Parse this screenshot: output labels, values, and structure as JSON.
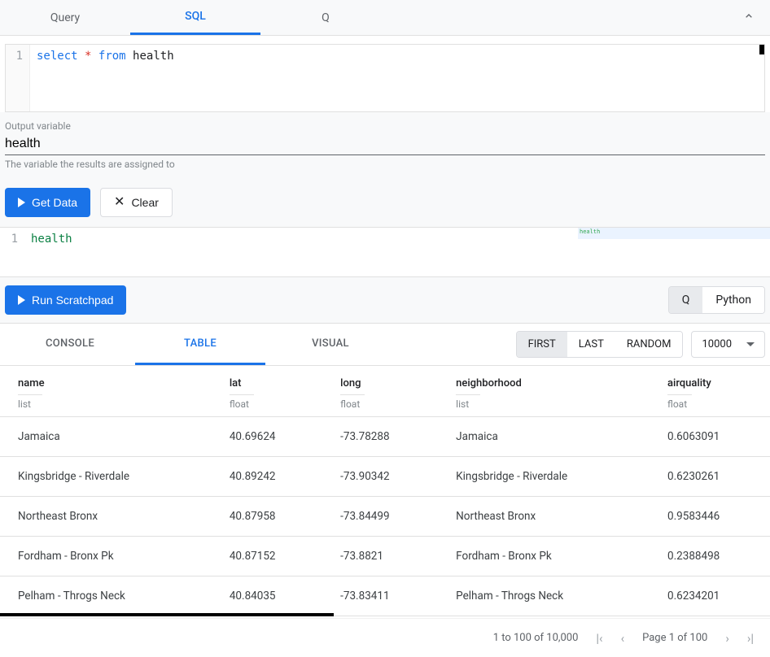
{
  "top_tabs": {
    "tab1": "Query",
    "tab2": "SQL",
    "tab3": "Q"
  },
  "editor": {
    "line_no": "1",
    "kw_select": "select",
    "star": "*",
    "kw_from": "from",
    "ident": "health"
  },
  "outvar": {
    "label": "Output variable",
    "value": "health",
    "hint": "The variable the results are assigned to"
  },
  "buttons": {
    "get_data": "Get Data",
    "clear": "Clear",
    "run_scratchpad": "Run Scratchpad"
  },
  "scratch": {
    "line_no": "1",
    "code": "health",
    "minimap": "health"
  },
  "lang": {
    "q": "Q",
    "python": "Python"
  },
  "result_tabs": {
    "console": "CONSOLE",
    "table": "TABLE",
    "visual": "VISUAL"
  },
  "modes": {
    "first": "FIRST",
    "last": "LAST",
    "random": "RANDOM"
  },
  "limit": "10000",
  "columns": [
    {
      "name": "name",
      "type": "list"
    },
    {
      "name": "lat",
      "type": "float"
    },
    {
      "name": "long",
      "type": "float"
    },
    {
      "name": "neighborhood",
      "type": "list"
    },
    {
      "name": "airquality",
      "type": "float"
    }
  ],
  "rows": [
    {
      "c0": "Jamaica",
      "c1": "40.69624",
      "c2": "-73.78288",
      "c3": "Jamaica",
      "c4": "0.6063091"
    },
    {
      "c0": "Kingsbridge - Riverdale",
      "c1": "40.89242",
      "c2": "-73.90342",
      "c3": "Kingsbridge - Riverdale",
      "c4": "0.6230261"
    },
    {
      "c0": "Northeast Bronx",
      "c1": "40.87958",
      "c2": "-73.84499",
      "c3": "Northeast Bronx",
      "c4": "0.9583446"
    },
    {
      "c0": "Fordham - Bronx Pk",
      "c1": "40.87152",
      "c2": "-73.8821",
      "c3": "Fordham - Bronx Pk",
      "c4": "0.2388498"
    },
    {
      "c0": "Pelham - Throgs Neck",
      "c1": "40.84035",
      "c2": "-73.83411",
      "c3": "Pelham - Throgs Neck",
      "c4": "0.6234201"
    }
  ],
  "pagination": {
    "range": "1 to 100 of 10,000",
    "page": "Page 1 of 100"
  }
}
